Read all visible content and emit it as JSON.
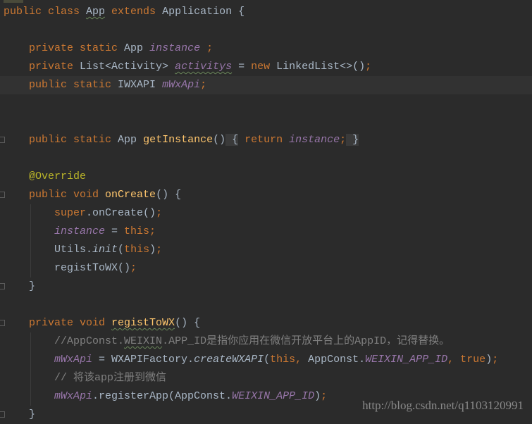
{
  "editor": {
    "theme_colors": {
      "background": "#2b2b2b",
      "keyword": "#cc7832",
      "identifier": "#a9b7c6",
      "field": "#9876aa",
      "method_declaration": "#ffc66d",
      "annotation": "#bbb529",
      "comment": "#808080"
    },
    "current_line": 4,
    "lines": [
      {
        "indent": 0,
        "tokens": [
          [
            "kw",
            "public class "
          ],
          [
            "id warn",
            "App"
          ],
          [
            "kw",
            " extends "
          ],
          [
            "id",
            "Application {"
          ]
        ]
      },
      {
        "indent": 0,
        "tokens": []
      },
      {
        "indent": 1,
        "tokens": [
          [
            "kw",
            "private static "
          ],
          [
            "id",
            "App "
          ],
          [
            "field",
            "instance"
          ],
          [
            "kw",
            " ;"
          ]
        ]
      },
      {
        "indent": 1,
        "tokens": [
          [
            "kw",
            "private "
          ],
          [
            "id",
            "List<Activity> "
          ],
          [
            "field warn",
            "activitys"
          ],
          [
            "id",
            " = "
          ],
          [
            "kw",
            "new "
          ],
          [
            "id",
            "LinkedList<>()"
          ],
          [
            "kw",
            ";"
          ]
        ]
      },
      {
        "indent": 1,
        "tokens": [
          [
            "kw",
            "public static "
          ],
          [
            "id",
            "IWXAPI "
          ],
          [
            "field",
            "mWxApi"
          ],
          [
            "kw",
            ";"
          ]
        ]
      },
      {
        "indent": 0,
        "tokens": []
      },
      {
        "indent": 0,
        "tokens": []
      },
      {
        "indent": 1,
        "fold": true,
        "tokens": [
          [
            "kw",
            "public static "
          ],
          [
            "id",
            "App "
          ],
          [
            "method",
            "getInstance"
          ],
          [
            "id",
            "()"
          ],
          [
            "id foldbox",
            " {"
          ],
          [
            "kw",
            " return "
          ],
          [
            "field",
            "instance"
          ],
          [
            "kw",
            ";"
          ],
          [
            "id foldbox",
            " }"
          ]
        ]
      },
      {
        "indent": 0,
        "tokens": []
      },
      {
        "indent": 1,
        "tokens": [
          [
            "ann",
            "@Override"
          ]
        ]
      },
      {
        "indent": 1,
        "fold": true,
        "tokens": [
          [
            "kw",
            "public void "
          ],
          [
            "method",
            "onCreate"
          ],
          [
            "id",
            "() {"
          ]
        ]
      },
      {
        "indent": 2,
        "tokens": [
          [
            "kw",
            "super"
          ],
          [
            "id",
            ".onCreate()"
          ],
          [
            "kw",
            ";"
          ]
        ]
      },
      {
        "indent": 2,
        "tokens": [
          [
            "field",
            "instance"
          ],
          [
            "id",
            " = "
          ],
          [
            "kw",
            "this;"
          ]
        ]
      },
      {
        "indent": 2,
        "tokens": [
          [
            "id",
            "Utils."
          ],
          [
            "smethod",
            "init"
          ],
          [
            "id",
            "("
          ],
          [
            "kw",
            "this"
          ],
          [
            "id",
            ")"
          ],
          [
            "kw",
            ";"
          ]
        ]
      },
      {
        "indent": 2,
        "tokens": [
          [
            "id",
            "registToWX()"
          ],
          [
            "kw",
            ";"
          ]
        ]
      },
      {
        "indent": 1,
        "fold": true,
        "tokens": [
          [
            "id",
            "}"
          ]
        ]
      },
      {
        "indent": 0,
        "tokens": []
      },
      {
        "indent": 1,
        "fold": true,
        "tokens": [
          [
            "kw",
            "private void "
          ],
          [
            "method warn",
            "registToWX"
          ],
          [
            "id",
            "() {"
          ]
        ]
      },
      {
        "indent": 2,
        "tokens": [
          [
            "comment",
            "//AppConst."
          ],
          [
            "comment warn",
            "WEIXIN"
          ],
          [
            "comment",
            ".APP_ID是指你应用在微信开放平台上的AppID，记得替换。"
          ]
        ]
      },
      {
        "indent": 2,
        "tokens": [
          [
            "field",
            "mWxApi"
          ],
          [
            "id",
            " = WXAPIFactory."
          ],
          [
            "smethod",
            "createWXAPI"
          ],
          [
            "id",
            "("
          ],
          [
            "kw",
            "this, "
          ],
          [
            "id",
            "AppConst."
          ],
          [
            "field",
            "WEIXIN_APP_ID"
          ],
          [
            "kw",
            ", true"
          ],
          [
            "id",
            ")"
          ],
          [
            "kw",
            ";"
          ]
        ]
      },
      {
        "indent": 2,
        "tokens": [
          [
            "comment",
            "// 将该app注册到微信"
          ]
        ]
      },
      {
        "indent": 2,
        "tokens": [
          [
            "field",
            "mWxApi"
          ],
          [
            "id",
            ".registerApp(AppConst."
          ],
          [
            "field",
            "WEIXIN_APP_ID"
          ],
          [
            "id",
            ")"
          ],
          [
            "kw",
            ";"
          ]
        ]
      },
      {
        "indent": 1,
        "fold": true,
        "tokens": [
          [
            "id",
            "}"
          ]
        ]
      }
    ]
  },
  "watermark": "http://blog.csdn.net/q1103120991"
}
